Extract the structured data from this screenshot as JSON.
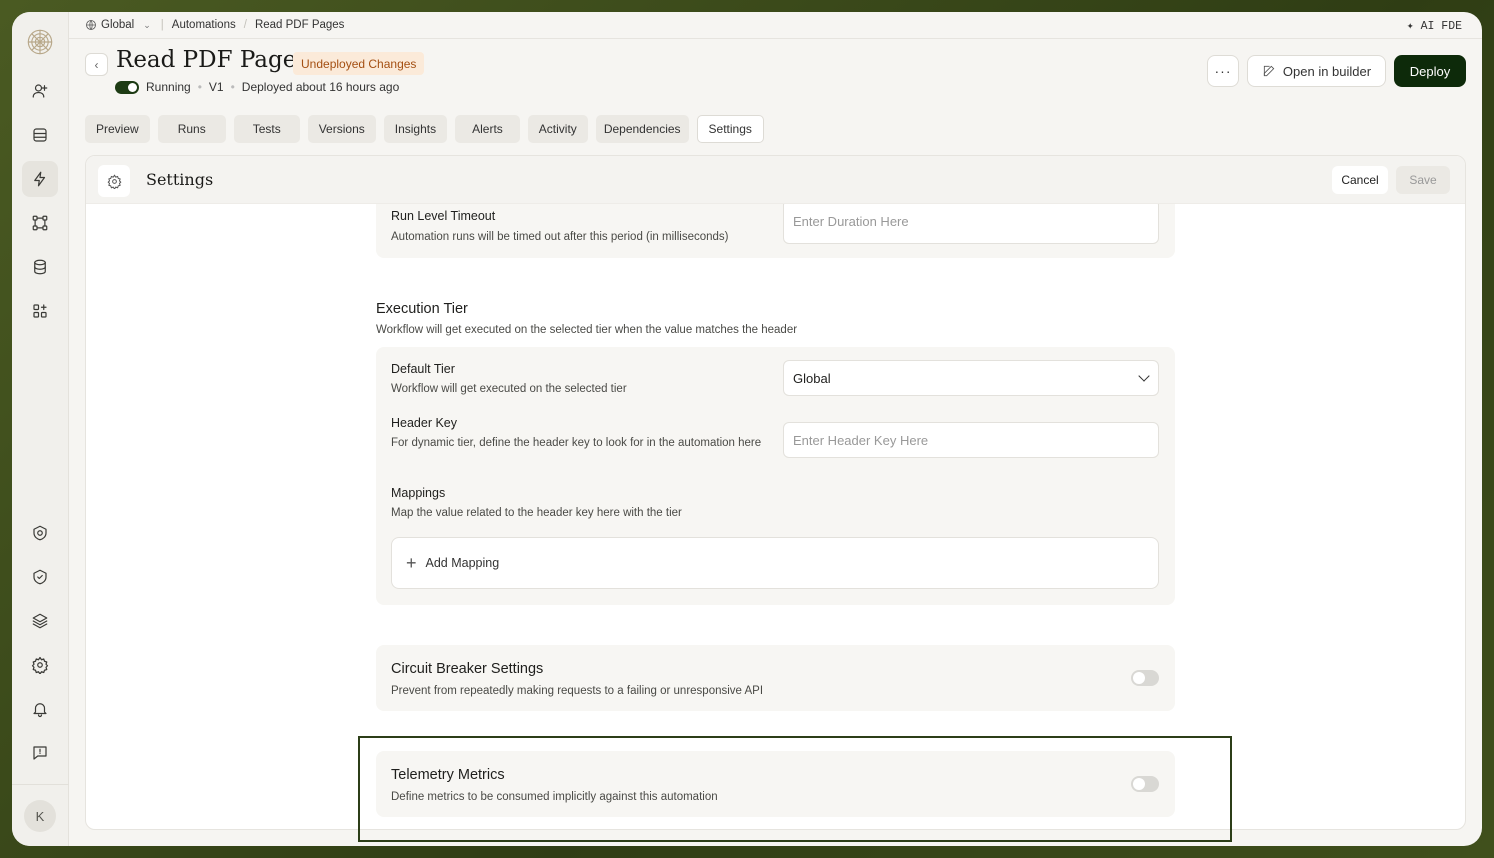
{
  "breadcrumb": {
    "scope": "Global",
    "section": "Automations",
    "current": "Read PDF Pages"
  },
  "top_right": "✦ AI FDE",
  "header": {
    "title": "Read PDF Pages",
    "badge": "Undeployed Changes",
    "status": "Running",
    "version": "V1",
    "deployed": "Deployed about 16 hours ago",
    "more_label": "···",
    "open_builder": "Open in builder",
    "deploy": "Deploy"
  },
  "tabs": [
    "Preview",
    "Runs",
    "Tests",
    "Versions",
    "Insights",
    "Alerts",
    "Activity",
    "Dependencies",
    "Settings"
  ],
  "active_tab": "Settings",
  "panel": {
    "title": "Settings",
    "cancel": "Cancel",
    "save": "Save"
  },
  "run_timeout": {
    "label": "Run Level Timeout",
    "desc": "Automation runs will be timed out after this period (in milliseconds)",
    "placeholder": "Enter Duration Here"
  },
  "execution_tier": {
    "title": "Execution Tier",
    "desc": "Workflow will get executed on the selected tier when the value matches the header",
    "default_tier": {
      "label": "Default Tier",
      "desc": "Workflow will get executed on the selected tier",
      "value": "Global"
    },
    "header_key": {
      "label": "Header Key",
      "desc": "For dynamic tier, define the header key to look for in the automation here",
      "placeholder": "Enter Header Key Here"
    },
    "mappings": {
      "label": "Mappings",
      "desc": "Map the value related to the header key here with the tier",
      "add": "Add Mapping"
    }
  },
  "circuit_breaker": {
    "title": "Circuit Breaker Settings",
    "desc": "Prevent from repeatedly making requests to a failing or unresponsive API",
    "enabled": false
  },
  "telemetry": {
    "title": "Telemetry Metrics",
    "desc": "Define metrics to be consumed implicitly against this automation",
    "enabled": false
  },
  "user": {
    "initial": "K"
  }
}
